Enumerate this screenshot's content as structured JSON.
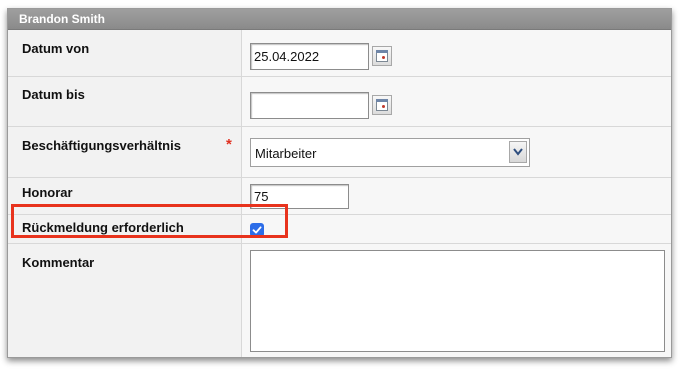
{
  "header": {
    "title": "Brandon Smith"
  },
  "form": {
    "datum_von": {
      "label": "Datum von",
      "value": "25.04.2022",
      "calendar_icon": "calendar-icon"
    },
    "datum_bis": {
      "label": "Datum bis",
      "value": "",
      "calendar_icon": "calendar-icon"
    },
    "beschaeftigung": {
      "label": "Beschäftigungsverhältnis",
      "required_marker": "*",
      "selected": "Mitarbeiter",
      "arrow_icon": "chevron-down-icon"
    },
    "honorar": {
      "label": "Honorar",
      "value": "75"
    },
    "rueckmeldung": {
      "label": "Rückmeldung erforderlich",
      "checked": true,
      "check_icon": "checkmark-icon"
    },
    "kommentar": {
      "label": "Kommentar",
      "value": ""
    }
  },
  "colors": {
    "header_bg": "#8f8f8f",
    "label_bg": "#f2f2f2",
    "value_bg": "#f7f7f7",
    "required": "#e03020",
    "checkbox": "#2d6de8",
    "highlight": "#e8331d"
  }
}
